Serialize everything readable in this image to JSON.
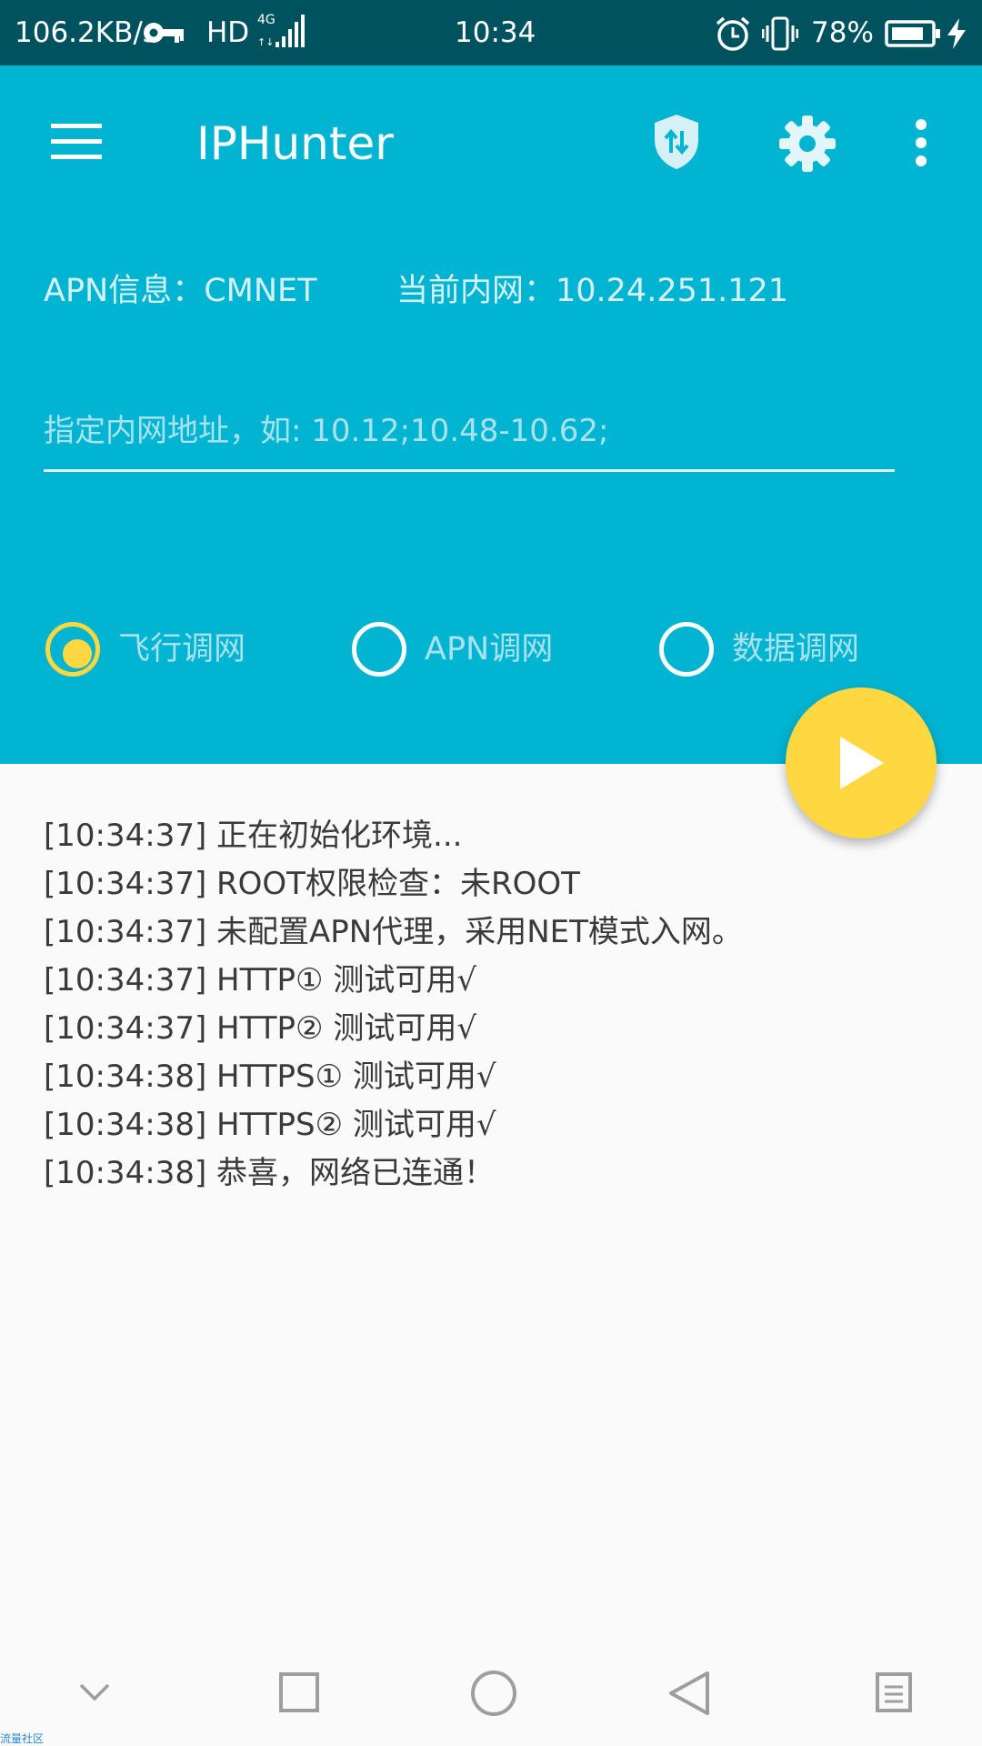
{
  "status_bar": {
    "net_speed": "106.2KB/s",
    "hd": "HD",
    "network": "4G",
    "time": "10:34",
    "battery": "78%",
    "icons": [
      "vpn-key-icon",
      "signal-icon",
      "alarm-icon",
      "vibrate-icon",
      "battery-icon",
      "charging-icon"
    ]
  },
  "app_bar": {
    "title": "IPHunter",
    "icons": [
      "menu-icon",
      "vpn-shield-icon",
      "settings-icon",
      "more-vert-icon"
    ]
  },
  "info": {
    "apn": "APN信息：CMNET",
    "intranet": "当前内网：10.24.251.121"
  },
  "ip_input": {
    "value": "",
    "placeholder": "指定内网地址，如: 10.12;10.48-10.62;"
  },
  "modes": [
    {
      "label": "飞行调网",
      "selected": true
    },
    {
      "label": "APN调网",
      "selected": false
    },
    {
      "label": "数据调网",
      "selected": false
    }
  ],
  "fab": {
    "icon": "play-icon"
  },
  "log": [
    "[10:34:37] 正在初始化环境...",
    "[10:34:37] ROOT权限检查：未ROOT",
    "[10:34:37] 未配置APN代理，采用NET模式入网。",
    "[10:34:37] HTTP①   测试可用√",
    "[10:34:37] HTTP②   测试可用√",
    "[10:34:38] HTTPS① 测试可用√",
    "[10:34:38] HTTPS② 测试可用√",
    "[10:34:38] 恭喜，网络已连通！"
  ],
  "nav_bar": {
    "icons": [
      "chevron-down-icon",
      "recents-icon",
      "home-icon",
      "back-icon",
      "menu-list-icon"
    ]
  },
  "watermark": "流量社区",
  "colors": {
    "status_bar": "#00525f",
    "header": "#00b4d2",
    "accent": "#ffd740",
    "background": "#fafafa"
  }
}
